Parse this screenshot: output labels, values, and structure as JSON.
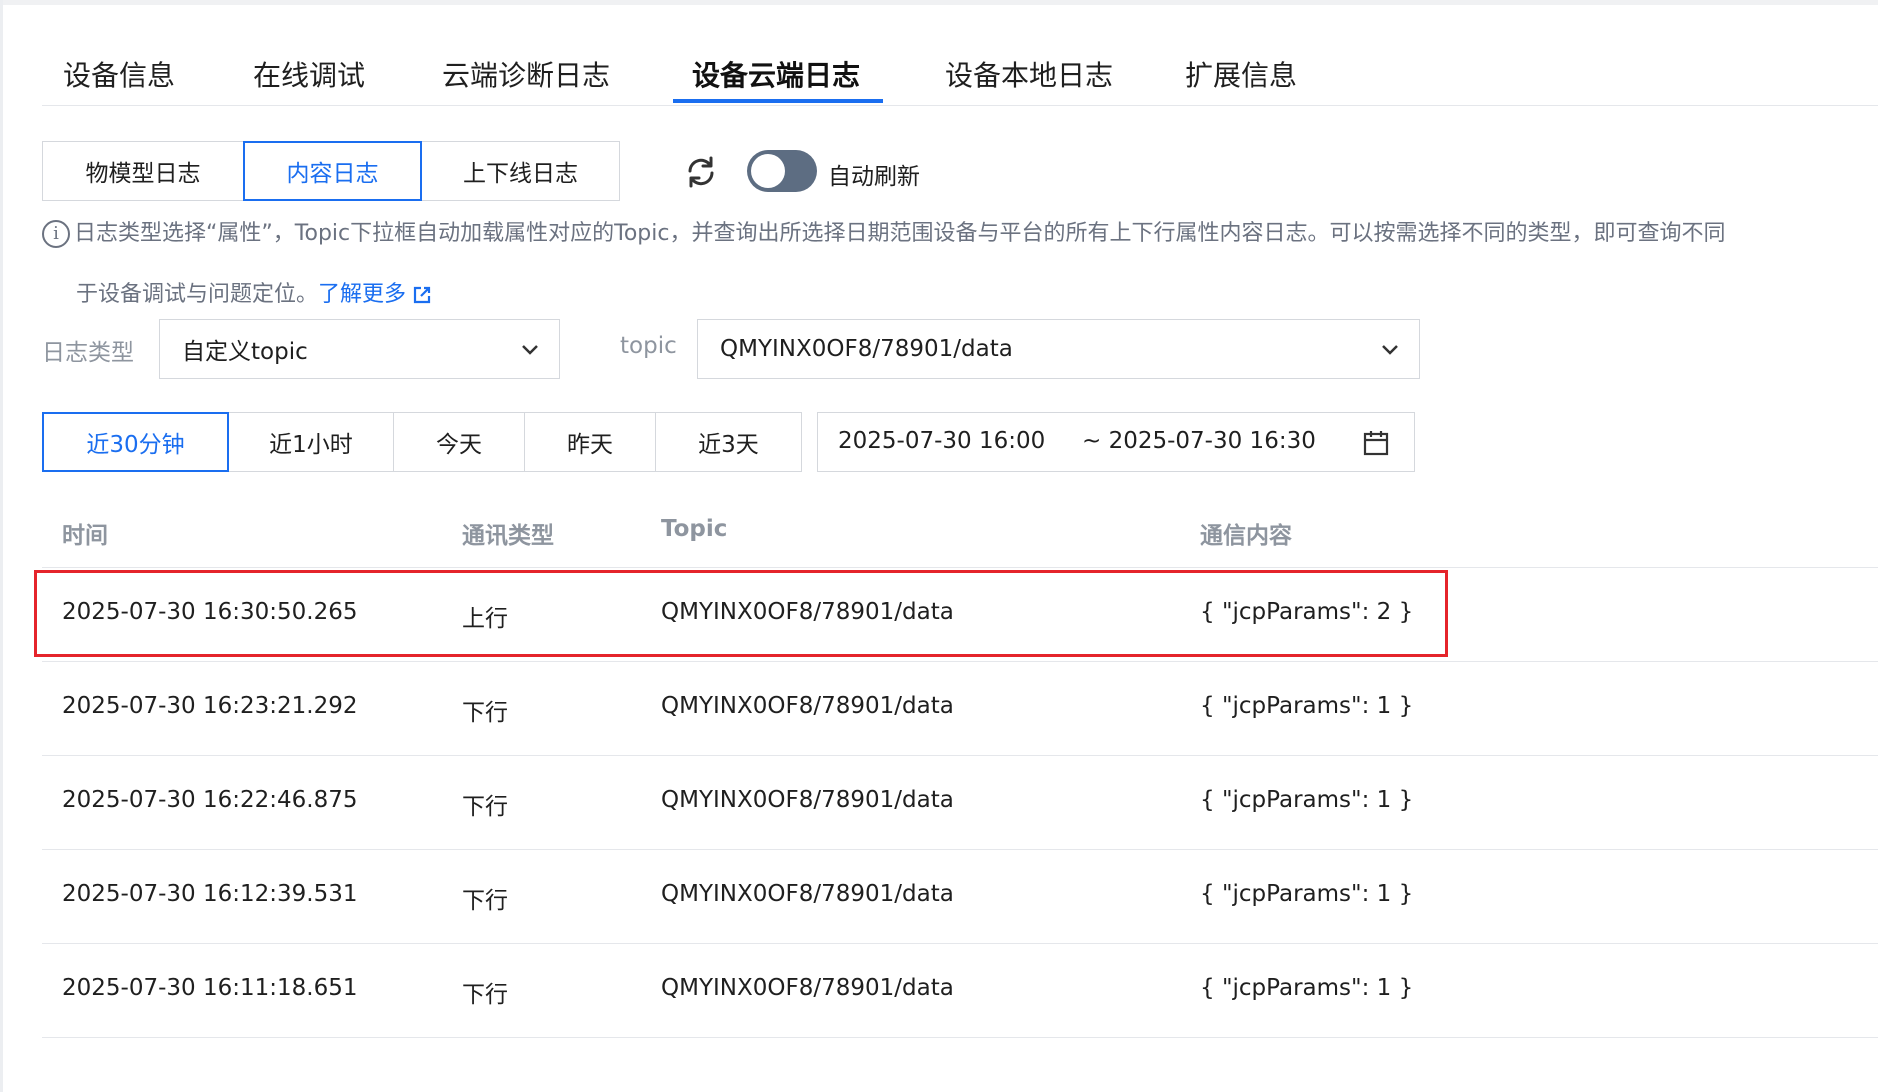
{
  "tabs": [
    {
      "label": "设备信息"
    },
    {
      "label": "在线调试"
    },
    {
      "label": "云端诊断日志"
    },
    {
      "label": "设备云端日志",
      "active": true
    },
    {
      "label": "设备本地日志"
    },
    {
      "label": "扩展信息"
    }
  ],
  "subtabs": [
    {
      "label": "物模型日志"
    },
    {
      "label": "内容日志",
      "active": true
    },
    {
      "label": "上下线日志"
    }
  ],
  "auto_refresh": {
    "label": "自动刷新",
    "enabled": false
  },
  "info": {
    "line1": "日志类型选择“属性”，Topic下拉框自动加载属性对应的Topic，并查询出所选择日期范围设备与平台的所有上下行属性内容日志。可以按需选择不同的类型，即可查询不同",
    "line2": "于设备调试与问题定位。",
    "link": "了解更多"
  },
  "filters": {
    "log_type_label": "日志类型",
    "log_type_value": "自定义topic",
    "topic_label": "topic",
    "topic_value": "QMYINX0OF8/78901/data"
  },
  "ranges": [
    {
      "label": "近30分钟",
      "active": true
    },
    {
      "label": "近1小时"
    },
    {
      "label": "今天"
    },
    {
      "label": "昨天"
    },
    {
      "label": "近3天"
    }
  ],
  "date_range": {
    "start": "2025-07-30 16:00",
    "end": "~ 2025-07-30 16:30"
  },
  "table": {
    "headers": [
      "时间",
      "通讯类型",
      "Topic",
      "通信内容"
    ],
    "rows": [
      [
        "2025-07-30 16:30:50.265",
        "上行",
        "QMYINX0OF8/78901/data",
        "{ \"jcpParams\": 2 }"
      ],
      [
        "2025-07-30 16:23:21.292",
        "下行",
        "QMYINX0OF8/78901/data",
        "{ \"jcpParams\": 1 }"
      ],
      [
        "2025-07-30 16:22:46.875",
        "下行",
        "QMYINX0OF8/78901/data",
        "{ \"jcpParams\": 1 }"
      ],
      [
        "2025-07-30 16:12:39.531",
        "下行",
        "QMYINX0OF8/78901/data",
        "{ \"jcpParams\": 1 }"
      ],
      [
        "2025-07-30 16:11:18.651",
        "下行",
        "QMYINX0OF8/78901/data",
        "{ \"jcpParams\": 1 }"
      ]
    ]
  },
  "colors": {
    "accent": "#1a6ef0",
    "highlight": "#e5242b",
    "toggle_off": "#5d6d82"
  },
  "icons": {
    "refresh": "refresh-icon",
    "info": "info-icon",
    "external": "external-link-icon",
    "calendar": "calendar-icon",
    "dropdown": "chevron-down-icon"
  }
}
